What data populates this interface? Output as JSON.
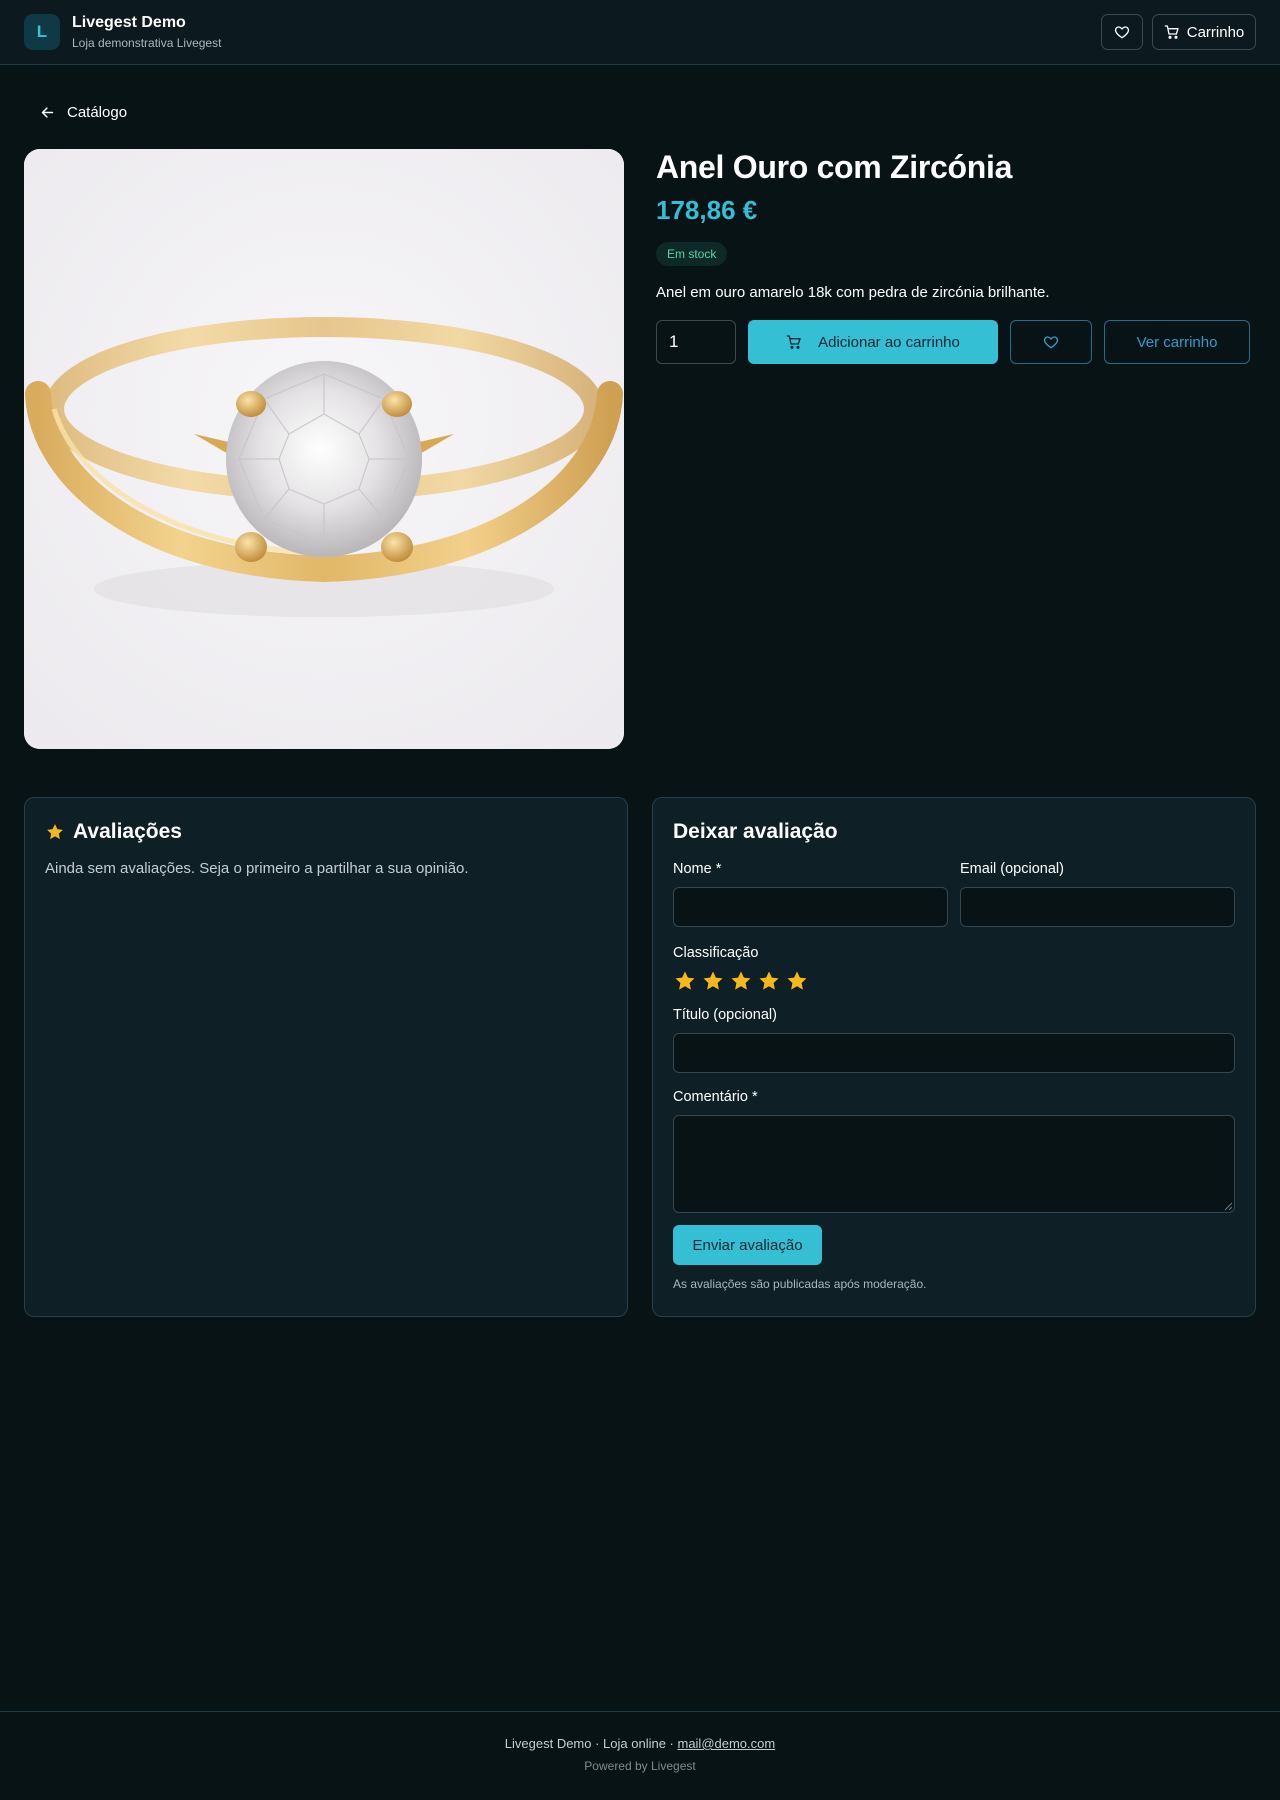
{
  "header": {
    "logo_letter": "L",
    "store_name": "Livegest Demo",
    "store_subtitle": "Loja demonstrativa Livegest",
    "cart_label": "Carrinho"
  },
  "nav": {
    "back_label": "Catálogo"
  },
  "product": {
    "title": "Anel Ouro com Zircónia",
    "price": "178,86 €",
    "stock_badge": "Em stock",
    "description": "Anel em ouro amarelo 18k com pedra de zircónia brilhante.",
    "quantity": "1",
    "add_to_cart_label": "Adicionar ao carrinho",
    "view_cart_label": "Ver carrinho"
  },
  "reviews": {
    "title": "Avaliações",
    "empty_text": "Ainda sem avaliações. Seja o primeiro a partilhar a sua opinião."
  },
  "review_form": {
    "title": "Deixar avaliação",
    "name_label": "Nome *",
    "email_label": "Email (opcional)",
    "rating_label": "Classificação",
    "rating_value": 5,
    "rating_max": 5,
    "review_title_label": "Título (opcional)",
    "comment_label": "Comentário *",
    "submit_label": "Enviar avaliação",
    "note": "As avaliações são publicadas após moderação."
  },
  "footer": {
    "info": "Livegest Demo · Loja online · ",
    "email": "mail@demo.com",
    "powered": "Powered by Livegest"
  },
  "colors": {
    "accent": "#34bfd4",
    "background": "#081316",
    "star": "#f5b81c",
    "stock_green": "#58d3a2"
  }
}
